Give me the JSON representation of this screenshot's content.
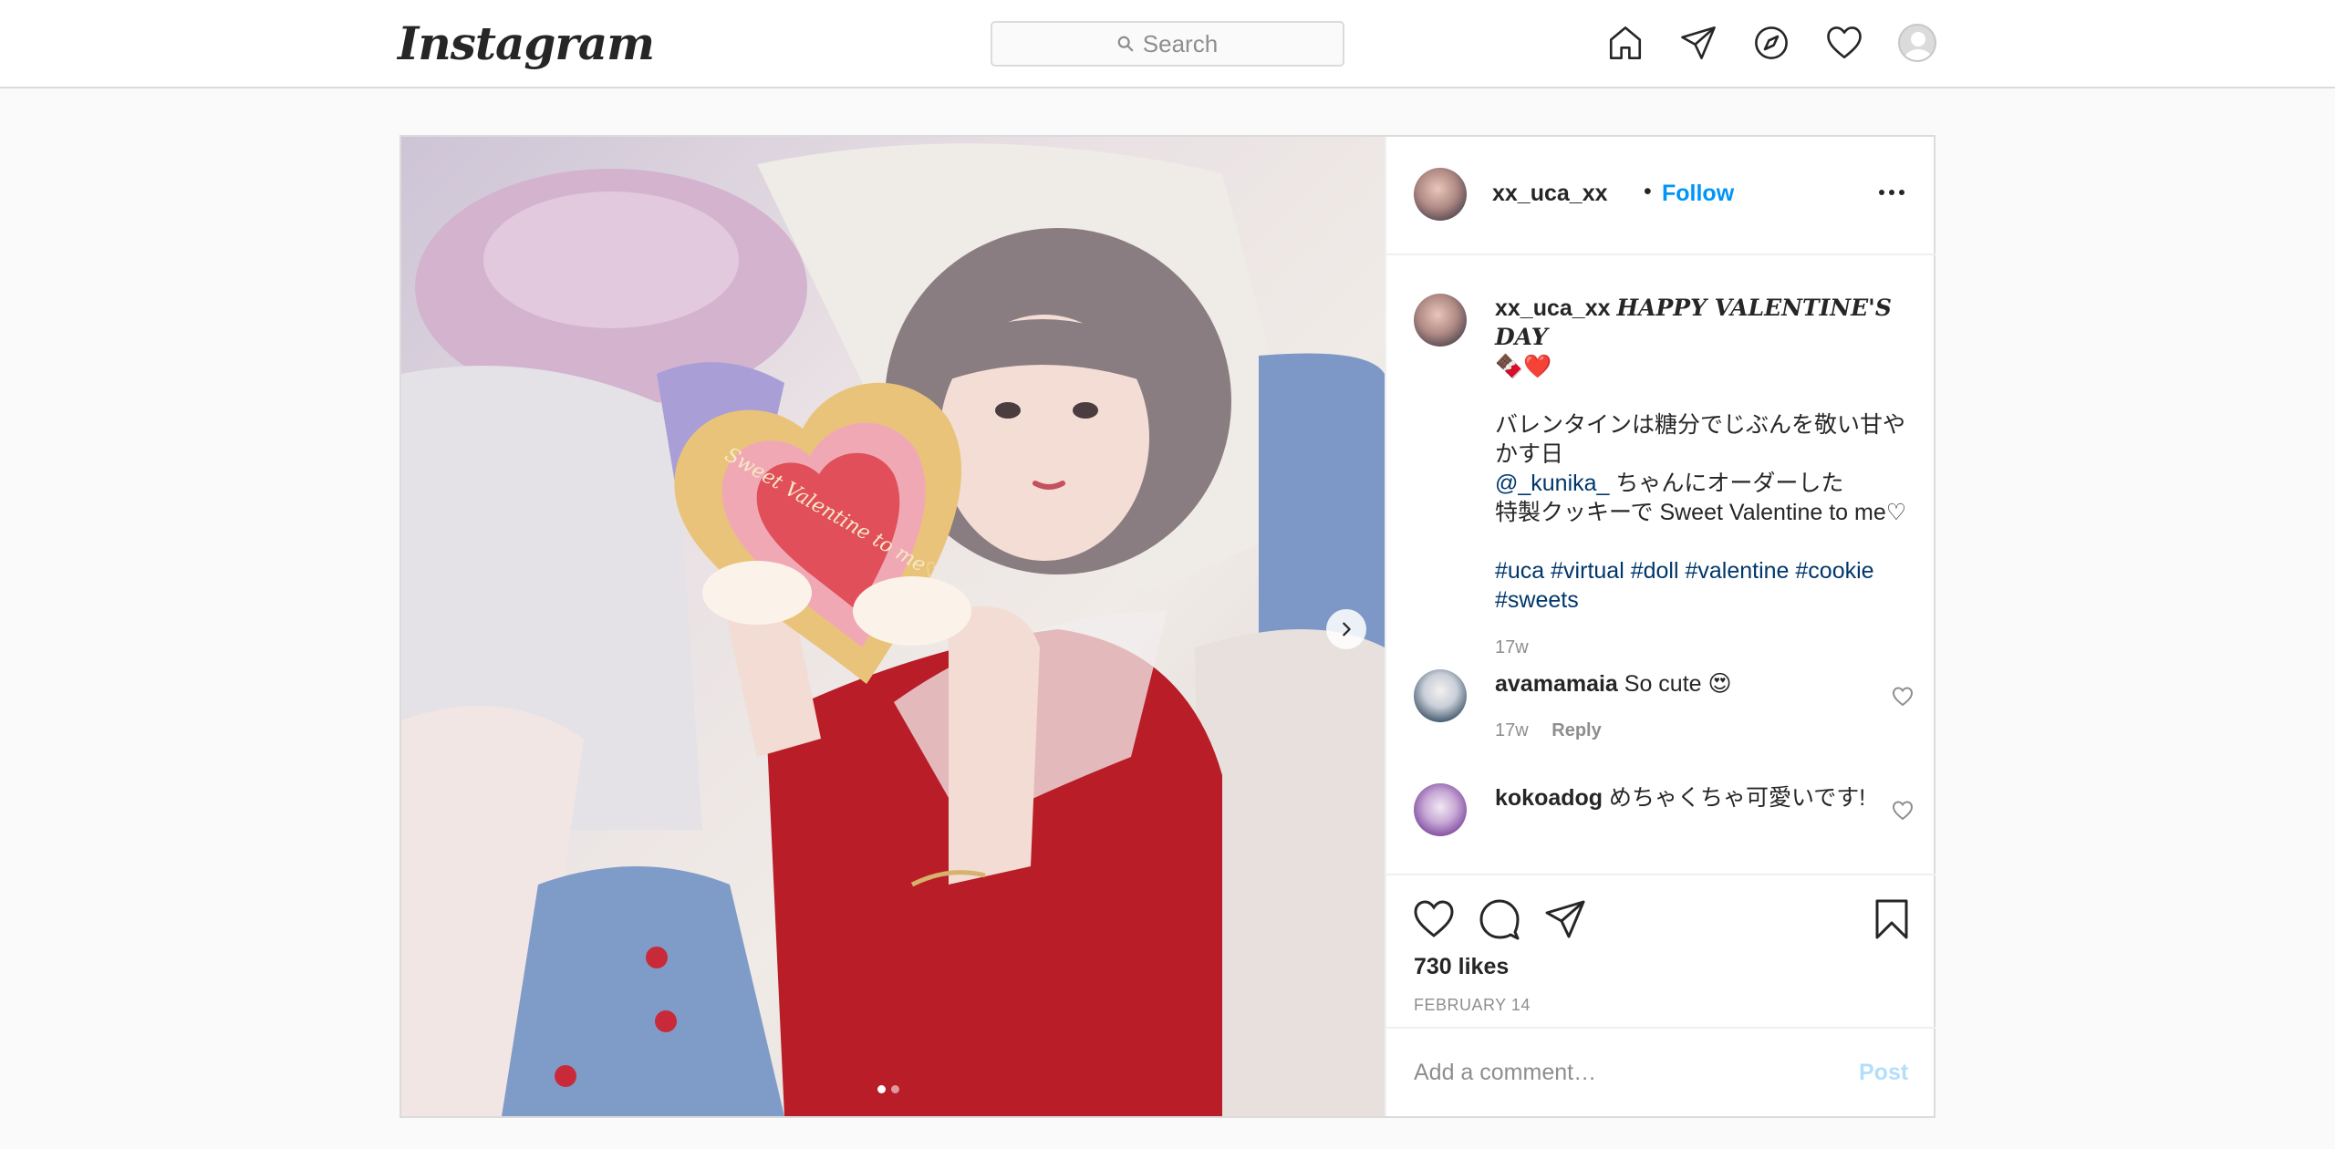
{
  "header": {
    "logo": "Instagram",
    "search_placeholder": "Search",
    "nav_icons": [
      "home-icon",
      "direct-icon",
      "explore-icon",
      "activity-icon",
      "profile-avatar"
    ]
  },
  "post": {
    "username": "xx_uca_xx",
    "separator": "•",
    "follow_label": "Follow",
    "more_icon": "more-icon",
    "media": {
      "cookie_text": "Sweet Valentine to me♡",
      "current_slide": 1,
      "total_slides": 2
    },
    "caption": {
      "username": "xx_uca_xx",
      "title": "HAPPY VALENTINE'S DAY",
      "emoji": "🍫❤️",
      "line1": "バレンタインは糖分でじぶんを敬い甘やかす日",
      "mention": "@_kunika_",
      "line2": " ちゃんにオーダーした",
      "line3": "特製クッキーで Sweet Valentine to me♡",
      "hashtags": "#uca #virtual #doll #valentine #cookie #sweets",
      "time": "17w"
    },
    "comments": [
      {
        "username": "avamamaia",
        "text": " So cute 😍",
        "time": "17w",
        "reply_label": "Reply"
      },
      {
        "username": "kokoadog",
        "text": " めちゃくちゃ可愛いです!"
      }
    ],
    "likes": "730 likes",
    "date": "FEBRUARY 14",
    "add_comment_placeholder": "Add a comment…",
    "post_button": "Post"
  },
  "colors": {
    "accent": "#0095f6",
    "link": "#00376b",
    "muted": "#8e8e8e",
    "border": "#dbdbdb",
    "post_disabled": "#b2dffc"
  }
}
